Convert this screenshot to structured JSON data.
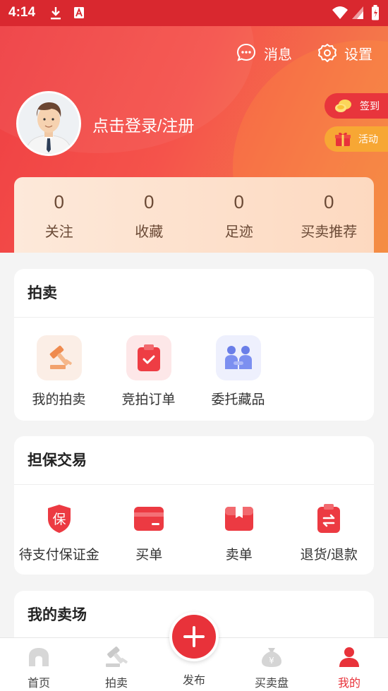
{
  "status_bar": {
    "time": "4:14"
  },
  "header": {
    "messages_label": "消息",
    "settings_label": "设置",
    "login_text": "点击登录/注册",
    "signin_label": "签到",
    "activity_label": "活动"
  },
  "stats": [
    {
      "value": "0",
      "label": "关注"
    },
    {
      "value": "0",
      "label": "收藏"
    },
    {
      "value": "0",
      "label": "足迹"
    },
    {
      "value": "0",
      "label": "买卖推荐"
    }
  ],
  "auction": {
    "title": "拍卖",
    "items": [
      {
        "label": "我的拍卖",
        "icon": "gavel-icon"
      },
      {
        "label": "竞拍订单",
        "icon": "clipboard-check-icon"
      },
      {
        "label": "委托藏品",
        "icon": "handshake-icon"
      }
    ]
  },
  "escrow": {
    "title": "担保交易",
    "items": [
      {
        "label": "待支付保证金",
        "icon": "shield-icon",
        "badge": "保"
      },
      {
        "label": "买单",
        "icon": "card-icon"
      },
      {
        "label": "卖单",
        "icon": "box-icon"
      },
      {
        "label": "退货/退款",
        "icon": "refund-icon"
      }
    ]
  },
  "my_market": {
    "title": "我的卖场"
  },
  "bottom_nav": {
    "home": "首页",
    "auction": "拍卖",
    "publish": "发布",
    "trading": "买卖盘",
    "mine": "我的"
  },
  "colors": {
    "primary": "#e8323a",
    "orange": "#f7a734",
    "stats_text": "#6b4a36"
  }
}
